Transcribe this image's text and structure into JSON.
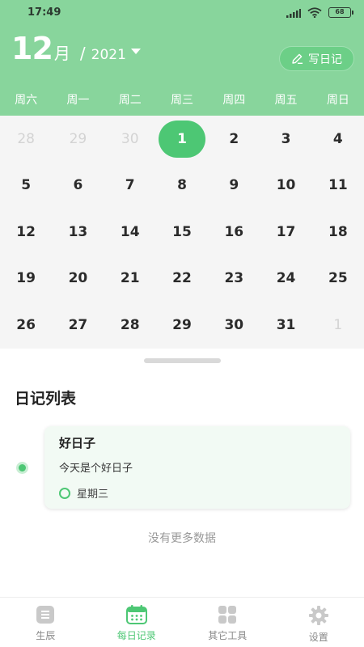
{
  "status": {
    "time": "17:49",
    "battery": "68"
  },
  "header": {
    "month": "12",
    "month_unit": "月",
    "slash": "/",
    "year": "2021",
    "write_button": "写日记"
  },
  "weekdays": [
    "周六",
    "周一",
    "周二",
    "周三",
    "周四",
    "周五",
    "周日"
  ],
  "calendar": {
    "days": [
      "28",
      "29",
      "30",
      "1",
      "2",
      "3",
      "4",
      "5",
      "6",
      "7",
      "8",
      "9",
      "10",
      "11",
      "12",
      "13",
      "14",
      "15",
      "16",
      "17",
      "18",
      "19",
      "20",
      "21",
      "22",
      "23",
      "24",
      "25",
      "26",
      "27",
      "28",
      "29",
      "30",
      "31",
      "1"
    ],
    "selected_day": "1"
  },
  "diary": {
    "section_title": "日记列表",
    "entries": [
      {
        "title": "好日子",
        "content": "今天是个好日子",
        "weekday": "星期三"
      }
    ],
    "no_more": "没有更多数据"
  },
  "nav": {
    "items": [
      {
        "label": "生辰",
        "icon": "list-icon"
      },
      {
        "label": "每日记录",
        "icon": "calendar-icon"
      },
      {
        "label": "其它工具",
        "icon": "grid-icon"
      },
      {
        "label": "设置",
        "icon": "gear-icon"
      }
    ],
    "active": "每日记录"
  },
  "colors": {
    "header_bg": "#88d59c",
    "accent": "#4dc774",
    "calendar_bg": "#f5f5f5",
    "card_bg": "#f2faf4"
  }
}
